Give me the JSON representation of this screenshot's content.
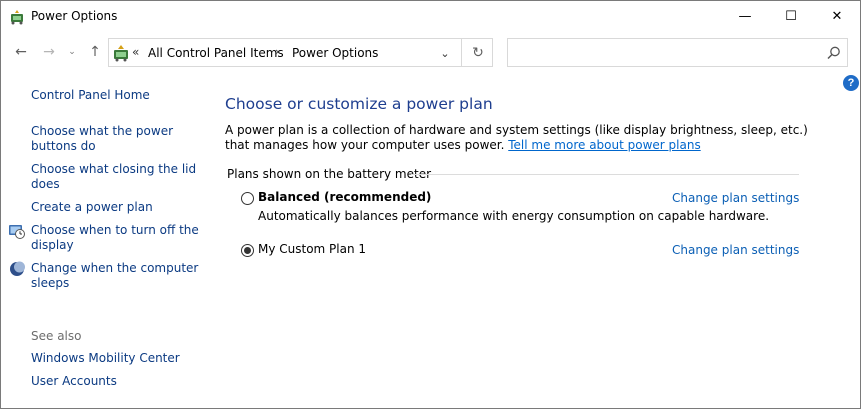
{
  "window": {
    "title": "Power Options",
    "controls": {
      "minimize": "—",
      "maximize": "☐",
      "close": "✕"
    }
  },
  "navigation": {
    "back": "←",
    "forward": "→",
    "recent": "⌄",
    "up": "↑",
    "address_chevron": "«",
    "breadcrumbs": [
      "All Control Panel Items",
      "Power Options"
    ],
    "separator": "›",
    "dropdown": "⌄",
    "refresh": "↻",
    "search_placeholder": ""
  },
  "left_pane": {
    "home_link": "Control Panel Home",
    "tasks": [
      {
        "label": "Choose what the power buttons do",
        "icon": null
      },
      {
        "label": "Choose what closing the lid does",
        "icon": null
      },
      {
        "label": "Create a power plan",
        "icon": null
      },
      {
        "label": "Choose when to turn off the display",
        "icon": "display-schedule-icon"
      },
      {
        "label": "Change when the computer sleeps",
        "icon": "sleep-moon-icon"
      }
    ],
    "see_also_heading": "See also",
    "see_also": [
      "Windows Mobility Center",
      "User Accounts"
    ]
  },
  "main": {
    "title": "Choose or customize a power plan",
    "description": "A power plan is a collection of hardware and system settings (like display brightness, sleep, etc.) that manages how your computer uses power.",
    "learn_more_link": "Tell me more about power plans",
    "group_label": "Plans shown on the battery meter",
    "plans": [
      {
        "name": "Balanced (recommended)",
        "bold": true,
        "selected": false,
        "description": "Automatically balances performance with energy consumption on capable hardware.",
        "link": "Change plan settings"
      },
      {
        "name": "My Custom Plan 1",
        "bold": false,
        "selected": true,
        "description": "",
        "link": "Change plan settings"
      }
    ]
  },
  "colors": {
    "title_blue": "#1e3e8f",
    "link_blue": "#0b3a82",
    "help_blue": "#1f6cc7"
  }
}
